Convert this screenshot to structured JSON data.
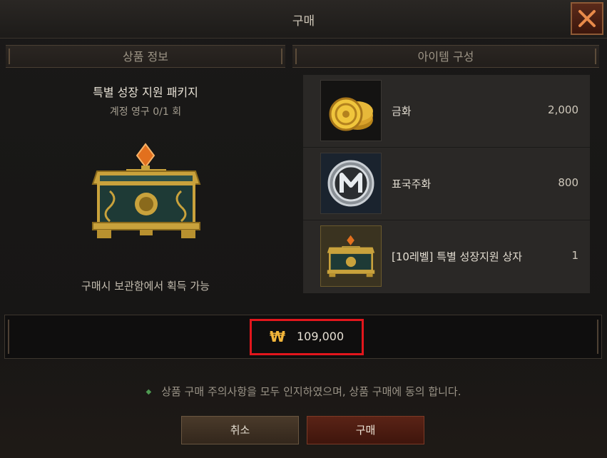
{
  "window": {
    "title": "구매",
    "close_icon": "close-icon"
  },
  "sections": {
    "product_info": "상품 정보",
    "item_composition": "아이템 구성"
  },
  "product": {
    "name": "특별 성장 지원 패키지",
    "limit": "계정 영구 0/1 회",
    "image_icon": "treasure-chest-icon",
    "note": "구매시 보관함에서 획득 가능"
  },
  "items": [
    {
      "name": "금화",
      "quantity": "2,000",
      "icon": "gold-coins-icon"
    },
    {
      "name": "표국주화",
      "quantity": "800",
      "icon": "silver-m-coin-icon"
    },
    {
      "name": "[10레벨] 특별 성장지원 상자",
      "quantity": "1",
      "icon": "treasure-chest-icon"
    }
  ],
  "price": {
    "currency_symbol": "₩",
    "amount": "109,000",
    "highlight_color": "#e2161c"
  },
  "notice": "상품 구매 주의사항을 모두 인지하였으며, 상품 구매에 동의 합니다.",
  "buttons": {
    "cancel": "취소",
    "buy": "구매"
  }
}
